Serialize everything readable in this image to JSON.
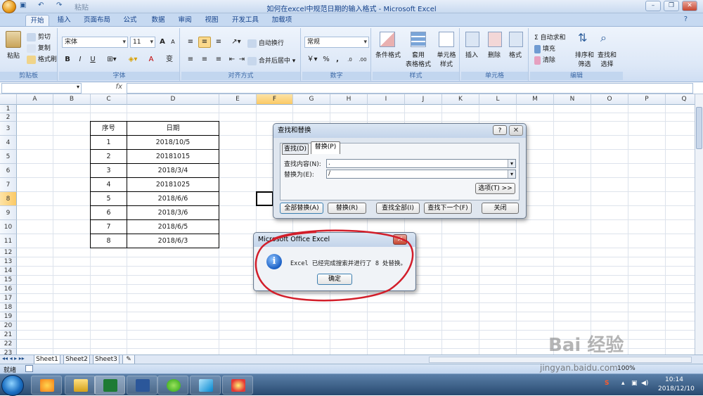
{
  "window": {
    "title": "如何在excel中规范日期的输入格式 - Microsoft Excel",
    "qat_label": "粘贴"
  },
  "tabs": [
    "开始",
    "插入",
    "页面布局",
    "公式",
    "数据",
    "审阅",
    "视图",
    "开发工具",
    "加载项"
  ],
  "ribbon": {
    "clipboard": {
      "paste": "粘贴",
      "cut": "剪切",
      "copy": "复制",
      "format_painter": "格式刷",
      "label": "剪贴板"
    },
    "font": {
      "name": "宋体",
      "size": "11",
      "bold": "B",
      "italic": "I",
      "underline": "U",
      "grow": "A",
      "shrink": "A",
      "color_a": "A",
      "wen": "变",
      "label": "字体"
    },
    "alignment": {
      "wrap": "自动换行",
      "merge": "合并后居中",
      "label": "对齐方式"
    },
    "number": {
      "format": "常规",
      "percent": "%",
      "comma": ",",
      "inc": ".0",
      "dec": ".00",
      "label": "数字"
    },
    "styles": {
      "cond": "条件格式",
      "table": "套用\n表格格式",
      "cell": "单元格\n样式",
      "label": "样式"
    },
    "cells": {
      "insert": "插入",
      "delete": "删除",
      "format": "格式",
      "label": "单元格"
    },
    "editing": {
      "autosum": "Σ 自动求和",
      "fill": "填充",
      "clear": "清除",
      "sort": "排序和\n筛选",
      "find": "查找和\n选择",
      "label": "编辑"
    }
  },
  "formula_bar": {
    "fx": "fx",
    "value": ""
  },
  "columns": [
    "A",
    "B",
    "C",
    "D",
    "E",
    "F",
    "G",
    "H",
    "I",
    "J",
    "K",
    "L",
    "M",
    "N",
    "O",
    "P",
    "Q"
  ],
  "rows": [
    "1",
    "2",
    "3",
    "4",
    "5",
    "6",
    "7",
    "8",
    "9",
    "10",
    "11",
    "12",
    "13",
    "14",
    "15",
    "16",
    "17",
    "18",
    "19",
    "20",
    "21",
    "22",
    "23"
  ],
  "table": {
    "headers": [
      "序号",
      "日期"
    ],
    "rows": [
      [
        "1",
        "2018/10/5"
      ],
      [
        "2",
        "20181015"
      ],
      [
        "3",
        "2018/3/4"
      ],
      [
        "4",
        "20181025"
      ],
      [
        "5",
        "2018/6/6"
      ],
      [
        "6",
        "2018/3/6"
      ],
      [
        "7",
        "2018/6/5"
      ],
      [
        "8",
        "2018/6/3"
      ]
    ]
  },
  "find_dialog": {
    "title": "查找和替换",
    "help": "?",
    "tab_find": "查找(D)",
    "tab_replace": "替换(P)",
    "find_label": "查找内容(N):",
    "find_value": ".",
    "replace_label": "替换为(E):",
    "replace_value": "/",
    "options": "选项(T) >>",
    "replace_all": "全部替换(A)",
    "replace": "替换(R)",
    "find_all": "查找全部(I)",
    "find_next": "查找下一个(F)",
    "close": "关闭"
  },
  "msg_dialog": {
    "title": "Microsoft Office Excel",
    "message": "Excel 已经完成搜索并进行了 8 处替换。",
    "ok": "确定",
    "close": "x"
  },
  "sheets": [
    "Sheet1",
    "Sheet2",
    "Sheet3"
  ],
  "status": {
    "ready": "就绪",
    "zoom": "100%"
  },
  "taskbar": {
    "time": "10:14",
    "date": "2018/12/10"
  },
  "watermark": {
    "text": "Bai 经验",
    "url": "jingyan.baidu.com"
  },
  "colors": {
    "accent": "#15428b",
    "selected_header": "#fbc965",
    "annotation_circle": "#d21e2a"
  }
}
